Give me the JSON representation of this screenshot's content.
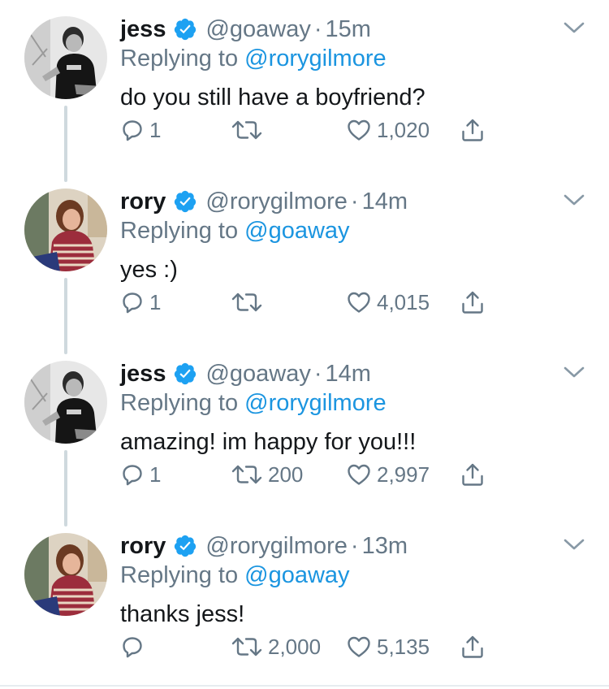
{
  "colors": {
    "text": "#14171a",
    "muted": "#657786",
    "link": "#1b95e0",
    "verified": "#1da1f2",
    "thread_line": "#cfd9de"
  },
  "tweets": [
    {
      "name": "jess",
      "handle": "@goaway",
      "separator": "·",
      "time": "15m",
      "replying_prefix": "Replying to ",
      "replying_to": "@rorygilmore",
      "text": "do you still have a boyfriend?",
      "reply_count": "1",
      "retweet_count": "",
      "like_count": "1,020",
      "avatar": "jess-avatar",
      "icons": [
        "verified-badge-icon",
        "chevron-down-icon",
        "reply-icon",
        "retweet-icon",
        "heart-icon",
        "share-icon"
      ]
    },
    {
      "name": "rory",
      "handle": "@rorygilmore",
      "separator": "·",
      "time": "14m",
      "replying_prefix": "Replying to ",
      "replying_to": "@goaway",
      "text": "yes :)",
      "reply_count": "1",
      "retweet_count": "",
      "like_count": "4,015",
      "avatar": "rory-avatar"
    },
    {
      "name": "jess",
      "handle": "@goaway",
      "separator": "·",
      "time": "14m",
      "replying_prefix": "Replying to ",
      "replying_to": "@rorygilmore",
      "text": "amazing! im happy for you!!!",
      "reply_count": "1",
      "retweet_count": "200",
      "like_count": "2,997",
      "avatar": "jess-avatar"
    },
    {
      "name": "rory",
      "handle": "@rorygilmore",
      "separator": "·",
      "time": "13m",
      "replying_prefix": "Replying to ",
      "replying_to": "@goaway",
      "text": "thanks jess!",
      "reply_count": "",
      "retweet_count": "2,000",
      "like_count": "5,135",
      "avatar": "rory-avatar"
    }
  ]
}
